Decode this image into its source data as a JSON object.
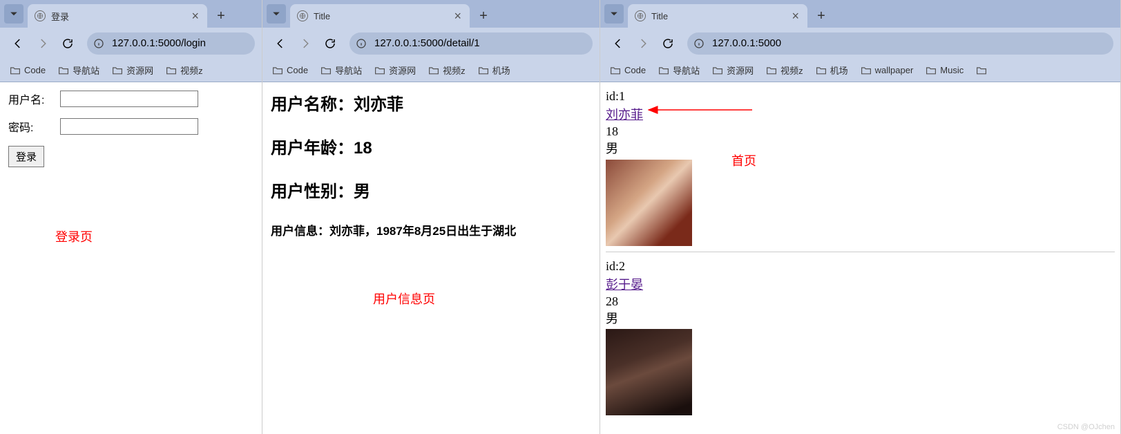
{
  "bookmarks": [
    "Code",
    "导航站",
    "资源网",
    "视频z",
    "机场",
    "wallpaper",
    "Music"
  ],
  "window1": {
    "tab_title": "登录",
    "url": "127.0.0.1:5000/login",
    "form": {
      "username_label": "用户名:",
      "password_label": "密码:",
      "submit_label": "登录"
    },
    "annotation": "登录页"
  },
  "window2": {
    "tab_title": "Title",
    "url": "127.0.0.1:5000/detail/1",
    "detail": {
      "name_label": "用户名称：",
      "name": "刘亦菲",
      "age_label": "用户年龄：",
      "age": "18",
      "gender_label": "用户性别：",
      "gender": "男",
      "info_label": "用户信息：",
      "info": "刘亦菲，1987年8月25日出生于湖北"
    },
    "annotation": "用户信息页"
  },
  "window3": {
    "tab_title": "Title",
    "url": "127.0.0.1:5000",
    "annotation": "首页",
    "users": [
      {
        "id_label": "id:1",
        "name": "刘亦菲",
        "age": "18",
        "gender": "男"
      },
      {
        "id_label": "id:2",
        "name": "彭于晏",
        "age": "28",
        "gender": "男"
      }
    ],
    "watermark": "CSDN @OJchen"
  }
}
